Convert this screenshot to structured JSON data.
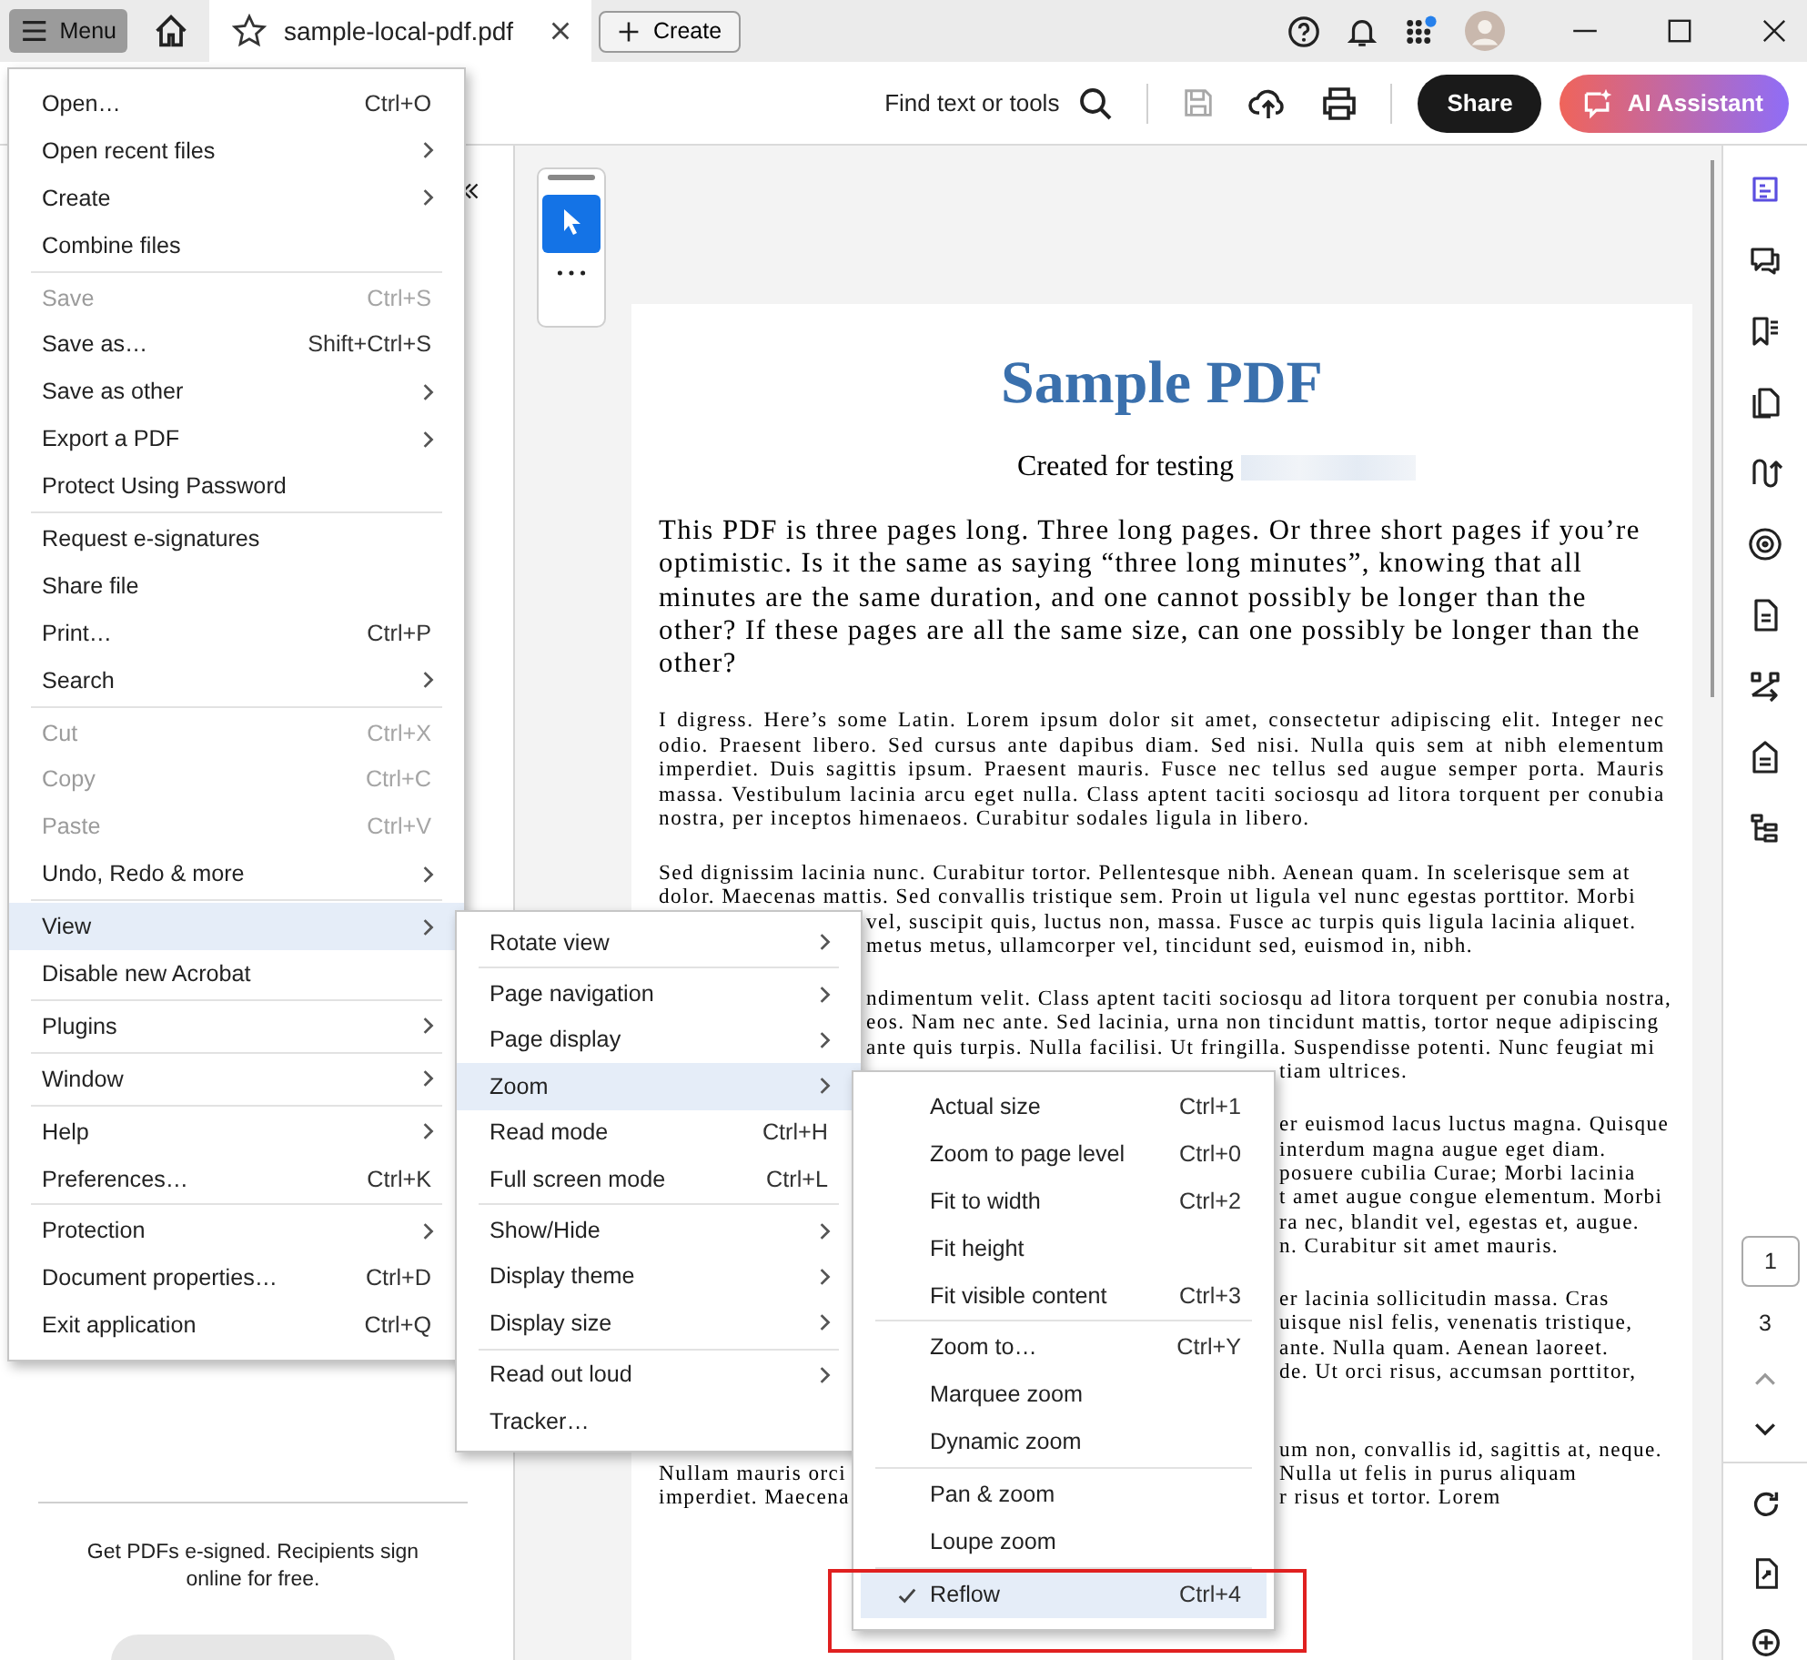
{
  "title_bar": {
    "menu_button": "Menu",
    "tab": {
      "title": "sample-local-pdf.pdf",
      "selected": true
    },
    "create_button": "Create",
    "apps_notification": true
  },
  "toolbar": {
    "search_label": "Find text or tools",
    "save_disabled": true,
    "share_button": "Share",
    "ai_button": "AI Assistant"
  },
  "left_panel": {
    "promo": "Get PDFs e-signed. Recipients sign online for free."
  },
  "pdf": {
    "title": "Sample PDF",
    "subtitle": "Created for testing",
    "intro": "This PDF is three pages long. Three long pages. Or three short pages if you’re optimistic. Is it the same as saying “three long minutes”, knowing that all minutes are the same duration, and one cannot possibly be longer than the other? If these pages are all the same size, can one possibly be longer than the other?",
    "paragraph_1": "I digress. Here’s some Latin. Lorem ipsum dolor sit amet, consectetur adipiscing elit. Integer nec odio. Praesent libero. Sed cursus ante dapibus diam. Sed nisi. Nulla quis sem at nibh elementum imperdiet. Duis sagittis ipsum. Praesent mauris. Fusce nec tellus sed augue semper porta. Mauris massa. Vestibulum lacinia arcu eget nulla. Class aptent taciti sociosqu ad litora torquent per conubia nostra, per inceptos himenaeos. Curabitur sodales ligula in libero.",
    "partial_paragraphs": [
      [
        {
          "left": "Sed dignissim lacinia nunc. Curabitur tortor. Pellentesque nibh. Aenean quam. In scelerisque sem at",
          "kind": "full"
        },
        {
          "left": "dolor. Maecenas mattis. Sed convallis tristique sem. Proin ut ligula vel nunc egestas porttitor. Morbi",
          "kind": "full"
        },
        {
          "right": "vel, suscipit quis, luctus non, massa. Fusce ac turpis quis ligula lacinia aliquet.",
          "kind": "after_view_menu"
        },
        {
          "right": "metus metus, ullamcorper vel, tincidunt sed, euismod in, nibh.",
          "kind": "after_view_menu"
        }
      ],
      [
        {
          "right": "ndimentum velit. Class aptent taciti sociosqu ad litora torquent per conubia nostra,",
          "kind": "after_view_menu"
        },
        {
          "right": "eos. Nam nec ante. Sed lacinia, urna non tincidunt mattis, tortor neque adipiscing",
          "kind": "after_view_menu"
        },
        {
          "right": "ante quis turpis. Nulla facilisi. Ut fringilla. Suspendisse potenti. Nunc feugiat mi",
          "kind": "after_view_menu"
        },
        {
          "right": "tiam ultrices.",
          "kind": "after_zoom_menu"
        }
      ],
      [
        {
          "right": "er euismod lacus luctus magna. Quisque",
          "kind": "after_zoom_menu"
        },
        {
          "right": "interdum magna augue eget diam.",
          "kind": "after_zoom_menu"
        },
        {
          "right": "posuere cubilia Curae; Morbi lacinia",
          "kind": "after_zoom_menu"
        },
        {
          "right": "t amet augue congue elementum. Morbi",
          "kind": "after_zoom_menu"
        },
        {
          "right": "ra nec, blandit vel, egestas et, augue.",
          "kind": "after_zoom_menu"
        },
        {
          "right": "n. Curabitur sit amet mauris.",
          "kind": "after_zoom_menu"
        }
      ],
      [
        {
          "right": "er lacinia sollicitudin massa. Cras",
          "kind": "after_zoom_menu"
        },
        {
          "right": "uisque nisl felis, venenatis tristique,",
          "kind": "after_zoom_menu"
        },
        {
          "right": "ante. Nulla quam. Aenean laoreet.",
          "kind": "after_zoom_menu"
        },
        {
          "right": "de. Ut orci risus, accumsan porttitor,",
          "kind": "after_zoom_menu"
        },
        {
          "kind": "covered"
        }
      ],
      [
        {
          "right": "um non, convallis id, sagittis at, neque.",
          "kind": "after_zoom_menu"
        },
        {
          "left": "Nullam mauris orci",
          "right": "Nulla ut felis in purus aliquam",
          "kind": "after_zoom_menu"
        },
        {
          "left": "imperdiet. Maecena",
          "right": "r risus et tortor. Lorem",
          "kind": "after_zoom_menu"
        }
      ]
    ]
  },
  "right_rail": {
    "tools": [
      {
        "selected": true
      },
      {
        "selected": false
      },
      {
        "selected": false
      },
      {
        "selected": false
      },
      {
        "selected": false
      },
      {
        "selected": false
      },
      {
        "selected": false
      },
      {
        "selected": false
      },
      {
        "selected": false
      },
      {
        "selected": false
      }
    ],
    "page_current": "1",
    "page_total": "3"
  },
  "main_menu": {
    "groups": [
      [
        {
          "label": "Open…",
          "shortcut": "Ctrl+O",
          "submenu": false,
          "disabled": false,
          "selected": false
        },
        {
          "label": "Open recent files",
          "submenu": true,
          "disabled": false,
          "selected": false
        },
        {
          "label": "Create",
          "submenu": true,
          "disabled": false,
          "selected": false
        },
        {
          "label": "Combine files",
          "submenu": false,
          "disabled": false,
          "selected": false
        }
      ],
      [
        {
          "label": "Save",
          "shortcut": "Ctrl+S",
          "submenu": false,
          "disabled": true,
          "selected": false
        },
        {
          "label": "Save as…",
          "shortcut": "Shift+Ctrl+S",
          "submenu": false,
          "disabled": false,
          "selected": false
        },
        {
          "label": "Save as other",
          "submenu": true,
          "disabled": false,
          "selected": false
        },
        {
          "label": "Export a PDF",
          "submenu": true,
          "disabled": false,
          "selected": false
        },
        {
          "label": "Protect Using Password",
          "submenu": false,
          "disabled": false,
          "selected": false
        }
      ],
      [
        {
          "label": "Request e-signatures",
          "submenu": false,
          "disabled": false,
          "selected": false
        },
        {
          "label": "Share file",
          "submenu": false,
          "disabled": false,
          "selected": false
        },
        {
          "label": "Print…",
          "shortcut": "Ctrl+P",
          "submenu": false,
          "disabled": false,
          "selected": false
        },
        {
          "label": "Search",
          "submenu": true,
          "disabled": false,
          "selected": false
        }
      ],
      [
        {
          "label": "Cut",
          "shortcut": "Ctrl+X",
          "submenu": false,
          "disabled": true,
          "selected": false
        },
        {
          "label": "Copy",
          "shortcut": "Ctrl+C",
          "submenu": false,
          "disabled": true,
          "selected": false
        },
        {
          "label": "Paste",
          "shortcut": "Ctrl+V",
          "submenu": false,
          "disabled": true,
          "selected": false
        },
        {
          "label": "Undo, Redo & more",
          "submenu": true,
          "disabled": false,
          "selected": false
        }
      ],
      [
        {
          "label": "View",
          "submenu": true,
          "disabled": false,
          "selected": true
        },
        {
          "label": "Disable new Acrobat",
          "submenu": false,
          "disabled": false,
          "selected": false
        }
      ],
      [
        {
          "label": "Plugins",
          "submenu": true,
          "disabled": false,
          "selected": false
        }
      ],
      [
        {
          "label": "Window",
          "submenu": true,
          "disabled": false,
          "selected": false
        }
      ],
      [
        {
          "label": "Help",
          "submenu": true,
          "disabled": false,
          "selected": false
        },
        {
          "label": "Preferences…",
          "shortcut": "Ctrl+K",
          "submenu": false,
          "disabled": false,
          "selected": false
        }
      ],
      [
        {
          "label": "Protection",
          "submenu": true,
          "disabled": false,
          "selected": false
        },
        {
          "label": "Document properties…",
          "shortcut": "Ctrl+D",
          "submenu": false,
          "disabled": false,
          "selected": false
        },
        {
          "label": "Exit application",
          "shortcut": "Ctrl+Q",
          "submenu": false,
          "disabled": false,
          "selected": false
        }
      ]
    ]
  },
  "view_submenu": {
    "groups": [
      [
        {
          "label": "Rotate view",
          "submenu": true,
          "disabled": false,
          "selected": false
        }
      ],
      [
        {
          "label": "Page navigation",
          "submenu": true,
          "disabled": false,
          "selected": false
        },
        {
          "label": "Page display",
          "submenu": true,
          "disabled": false,
          "selected": false
        },
        {
          "label": "Zoom",
          "submenu": true,
          "disabled": false,
          "selected": true
        },
        {
          "label": "Read mode",
          "shortcut": "Ctrl+H",
          "submenu": false,
          "disabled": false,
          "selected": false
        },
        {
          "label": "Full screen mode",
          "shortcut": "Ctrl+L",
          "submenu": false,
          "disabled": false,
          "selected": false
        }
      ],
      [
        {
          "label": "Show/Hide",
          "submenu": true,
          "disabled": false,
          "selected": false
        },
        {
          "label": "Display theme",
          "submenu": true,
          "disabled": false,
          "selected": false
        },
        {
          "label": "Display size",
          "submenu": true,
          "disabled": false,
          "selected": false
        }
      ],
      [
        {
          "label": "Read out loud",
          "submenu": true,
          "disabled": false,
          "selected": false
        },
        {
          "label": "Tracker…",
          "submenu": false,
          "disabled": false,
          "selected": false
        }
      ]
    ]
  },
  "zoom_submenu": {
    "groups": [
      [
        {
          "label": "Actual size",
          "shortcut": "Ctrl+1",
          "submenu": false,
          "disabled": false,
          "selected": false,
          "checked": false
        },
        {
          "label": "Zoom to page level",
          "shortcut": "Ctrl+0",
          "submenu": false,
          "disabled": false,
          "selected": false,
          "checked": false
        },
        {
          "label": "Fit to width",
          "shortcut": "Ctrl+2",
          "submenu": false,
          "disabled": false,
          "selected": false,
          "checked": false
        },
        {
          "label": "Fit height",
          "submenu": false,
          "disabled": false,
          "selected": false,
          "checked": false
        },
        {
          "label": "Fit visible content",
          "shortcut": "Ctrl+3",
          "submenu": false,
          "disabled": false,
          "selected": false,
          "checked": false
        }
      ],
      [
        {
          "label": "Zoom to…",
          "shortcut": "Ctrl+Y",
          "submenu": false,
          "disabled": false,
          "selected": false,
          "checked": false
        },
        {
          "label": "Marquee zoom",
          "submenu": false,
          "disabled": false,
          "selected": false,
          "checked": false
        },
        {
          "label": "Dynamic zoom",
          "submenu": false,
          "disabled": false,
          "selected": false,
          "checked": false
        }
      ],
      [
        {
          "label": "Pan & zoom",
          "submenu": false,
          "disabled": false,
          "selected": false,
          "checked": false
        },
        {
          "label": "Loupe zoom",
          "submenu": false,
          "disabled": false,
          "selected": false,
          "checked": false
        }
      ],
      [
        {
          "label": "Reflow",
          "shortcut": "Ctrl+4",
          "submenu": false,
          "disabled": false,
          "selected": true,
          "checked": true
        }
      ]
    ]
  }
}
